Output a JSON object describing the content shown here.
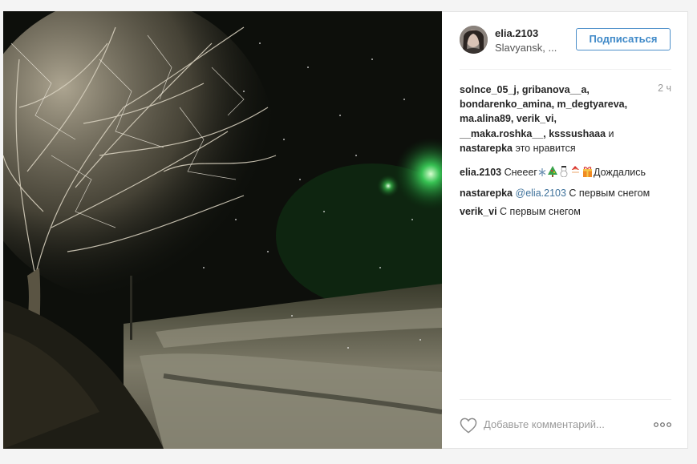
{
  "post": {
    "username": "elia.2103",
    "location": "Slavyansk, ...",
    "follow_label": "Подписаться",
    "time": "2 ч"
  },
  "likes": {
    "names_line1": "solnce_05_j, gribanova__a,",
    "names_line2": "bondarenko_amina, m_degtyareva,",
    "names_line3": "ma.alina89, verik_vi,",
    "names_line4a": "__maka.roshka__, ksssushaaa",
    "and_word": " и",
    "names_line5": "nastarepka",
    "suffix": " это нравится"
  },
  "comments": [
    {
      "user": "elia.2103",
      "text": " Снееег",
      "text2": "Дождались"
    },
    {
      "user": "nastarepka",
      "mention": "@elia.2103",
      "text": " С первым снегом"
    },
    {
      "user": "verik_vi",
      "text": " С первым снегом"
    }
  ],
  "footer": {
    "comment_placeholder": "Добавьте комментарий...",
    "more_label": "ooo"
  },
  "icons": {
    "like": "heart-outline-icon",
    "more": "more-options-icon"
  }
}
